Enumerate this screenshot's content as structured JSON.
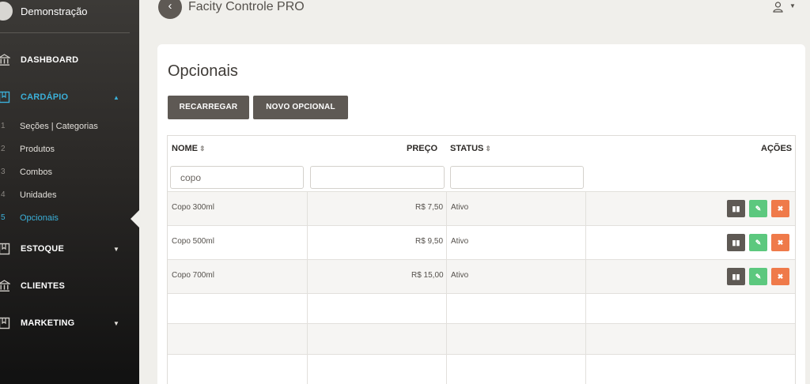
{
  "sidebar": {
    "user": "Demonstração",
    "menu": [
      {
        "label": "DASHBOARD"
      },
      {
        "label": "CARDÁPIO",
        "caret": "▲"
      },
      {
        "label": "ESTOQUE",
        "caret": "▼"
      },
      {
        "label": "CLIENTES"
      },
      {
        "label": "MARKETING",
        "caret": "▼"
      }
    ],
    "submenu": [
      {
        "num": "1",
        "label": "Seções | Categorias"
      },
      {
        "num": "2",
        "label": "Produtos"
      },
      {
        "num": "3",
        "label": "Combos"
      },
      {
        "num": "4",
        "label": "Unidades"
      },
      {
        "num": "5",
        "label": "Opcionais"
      }
    ]
  },
  "header": {
    "back_icon": "‹",
    "app_title": "Facity Controle PRO",
    "user_caret": "▼"
  },
  "page": {
    "title": "Opcionais",
    "buttons": {
      "reload": "RECARREGAR",
      "new": "NOVO OPCIONAL"
    }
  },
  "table": {
    "columns": {
      "name": "NOME",
      "price": "PREÇO",
      "status": "STATUS",
      "actions": "AÇÕES"
    },
    "sort_icon": "⇕",
    "filters": {
      "name": "copo",
      "price": "",
      "status": ""
    },
    "rows": [
      {
        "name": "Copo 300ml",
        "price": "R$ 7,50",
        "status": "Ativo"
      },
      {
        "name": "Copo 500ml",
        "price": "R$ 9,50",
        "status": "Ativo"
      },
      {
        "name": "Copo 700ml",
        "price": "R$ 15,00",
        "status": "Ativo"
      }
    ],
    "action_icons": {
      "view": "▮▮",
      "edit": "✎",
      "delete": "✖"
    }
  },
  "colors": {
    "accent": "#3bb0d9",
    "button_dark": "#5e5954",
    "edit_green": "#5cc87e",
    "delete_orange": "#ef7a4a"
  }
}
